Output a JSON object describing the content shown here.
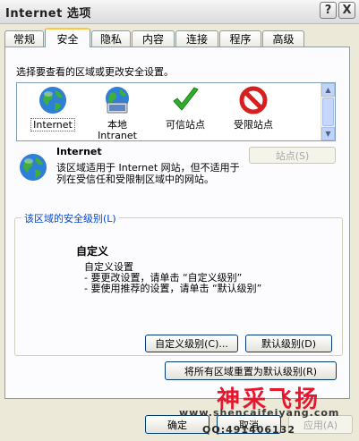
{
  "window": {
    "title": "Internet 选项"
  },
  "title_buttons": {
    "help": "?",
    "close": "X"
  },
  "tabs": [
    {
      "label": "常规"
    },
    {
      "label": "安全"
    },
    {
      "label": "隐私"
    },
    {
      "label": "内容"
    },
    {
      "label": "连接"
    },
    {
      "label": "程序"
    },
    {
      "label": "高级"
    }
  ],
  "zones_prompt": "选择要查看的区域或更改安全设置。",
  "zones": [
    {
      "label": "Internet",
      "label2": "",
      "icon": "globe-icon"
    },
    {
      "label": "本地",
      "label2": "Intranet",
      "icon": "local-intranet-icon"
    },
    {
      "label": "可信站点",
      "label2": "",
      "icon": "checkmark-icon"
    },
    {
      "label": "受限站点",
      "label2": "",
      "icon": "restricted-icon"
    }
  ],
  "selected_zone": {
    "name": "Internet",
    "description": "该区域适用于 Internet 网站，但不适用于列在受信任和受限制区域中的网站。",
    "sites_button": "站点(S)"
  },
  "security_level": {
    "group_label": "该区域的安全级别(L)",
    "level_name": "自定义",
    "level_desc": "自定义设置",
    "bullet1": "- 要更改设置，请单击 “自定义级别”",
    "bullet2": "- 要使用推荐的设置，请单击 “默认级别”",
    "custom_button": "自定义级别(C)...",
    "default_button": "默认级别(D)"
  },
  "reset_all_button": "将所有区域重置为默认级别(R)",
  "footer": {
    "ok": "确定",
    "cancel": "取消",
    "apply": "应用(A)"
  },
  "watermark": {
    "title": "神采飞扬",
    "url": "www.shencaifeiyang.com",
    "qq": "QQ:491406132"
  },
  "colors": {
    "accent_blue": "#0046d5",
    "tab_highlight": "#ffc83c",
    "watermark_red": "#e8162c"
  }
}
